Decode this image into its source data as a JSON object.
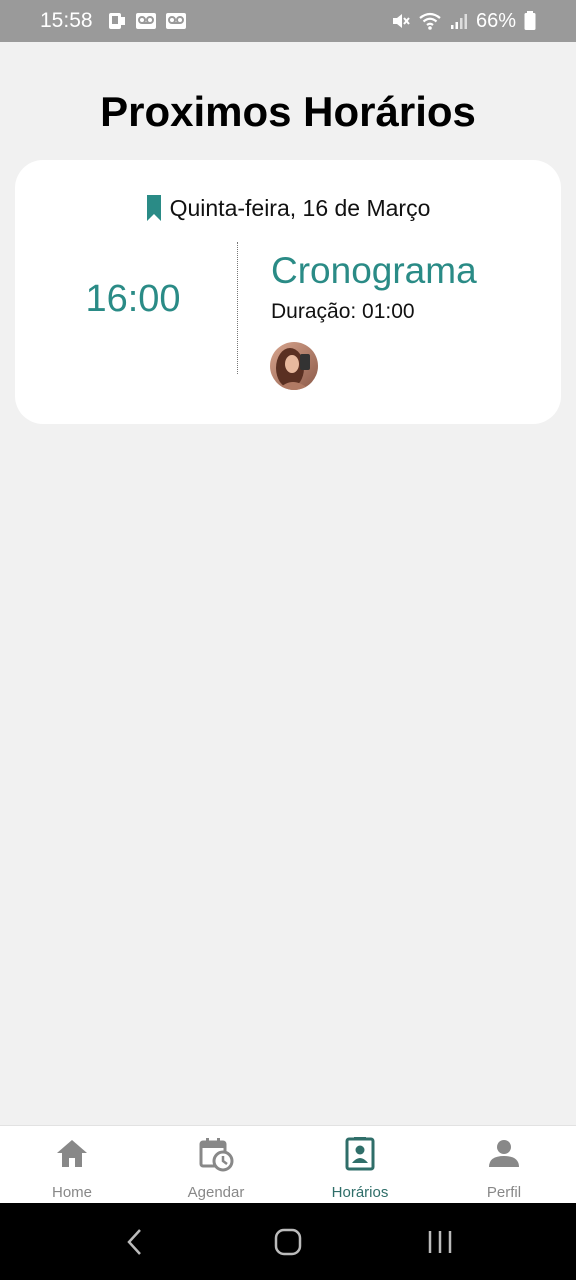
{
  "status_bar": {
    "time": "15:58",
    "battery": "66%",
    "icons": [
      "notification-icon",
      "voicemail-icon",
      "voicemail-icon",
      "mute-icon",
      "wifi-icon",
      "signal-icon",
      "battery-icon"
    ]
  },
  "page": {
    "title": "Proximos Horários"
  },
  "appointment": {
    "date": "Quinta-feira, 16 de Março",
    "time": "16:00",
    "service": "Cronograma",
    "duration": "Duração: 01:00"
  },
  "colors": {
    "accent": "#2a8b86",
    "active_nav": "#2f6e69",
    "inactive_nav": "#888888"
  },
  "bottom_nav": {
    "items": [
      {
        "label": "Home",
        "icon": "home-icon",
        "active": false
      },
      {
        "label": "Agendar",
        "icon": "calendar-clock-icon",
        "active": false
      },
      {
        "label": "Horários",
        "icon": "contact-book-icon",
        "active": true
      },
      {
        "label": "Perfil",
        "icon": "person-icon",
        "active": false
      }
    ]
  },
  "system_nav": {
    "icons": [
      "back-icon",
      "home-button-icon",
      "recents-icon"
    ]
  }
}
